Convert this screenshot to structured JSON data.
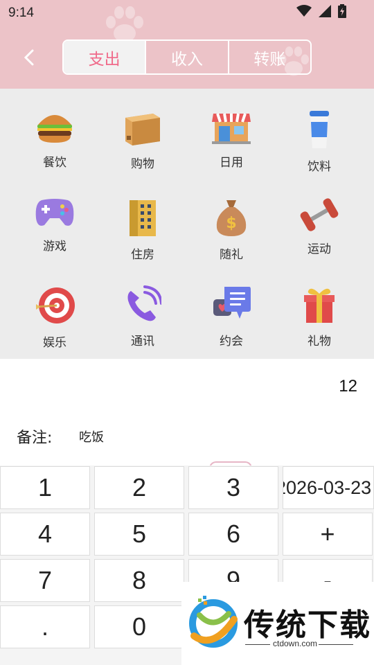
{
  "status_bar": {
    "time": "9:14"
  },
  "tabs": [
    {
      "label": "支出",
      "active": true
    },
    {
      "label": "收入",
      "active": false
    },
    {
      "label": "转账",
      "active": false
    }
  ],
  "categories": [
    {
      "label": "餐饮",
      "icon": "burger-icon"
    },
    {
      "label": "购物",
      "icon": "box-icon"
    },
    {
      "label": "日用",
      "icon": "shop-icon"
    },
    {
      "label": "饮料",
      "icon": "cup-icon"
    },
    {
      "label": "游戏",
      "icon": "gamepad-icon"
    },
    {
      "label": "住房",
      "icon": "building-icon"
    },
    {
      "label": "随礼",
      "icon": "money-bag-icon"
    },
    {
      "label": "运动",
      "icon": "dumbbell-icon"
    },
    {
      "label": "娱乐",
      "icon": "target-icon"
    },
    {
      "label": "通讯",
      "icon": "phone-icon"
    },
    {
      "label": "约会",
      "icon": "chat-icon"
    },
    {
      "label": "礼物",
      "icon": "gift-icon"
    }
  ],
  "amount": "12",
  "note": {
    "label": "备注:",
    "value": "吃饭"
  },
  "keypad": {
    "k1": "1",
    "k2": "2",
    "k3": "3",
    "date": "2026-03-23",
    "k4": "4",
    "k5": "5",
    "k6": "6",
    "plus": "+",
    "k7": "7",
    "k8": "8",
    "k9": "9",
    "minus": "-",
    "dot": ".",
    "k0": "0"
  },
  "watermark": {
    "brand": "传统下载",
    "url": "ctdown.com"
  },
  "colors": {
    "header": "#ecc3c8",
    "accent": "#f06a8a",
    "grid_bg": "#ececec"
  }
}
